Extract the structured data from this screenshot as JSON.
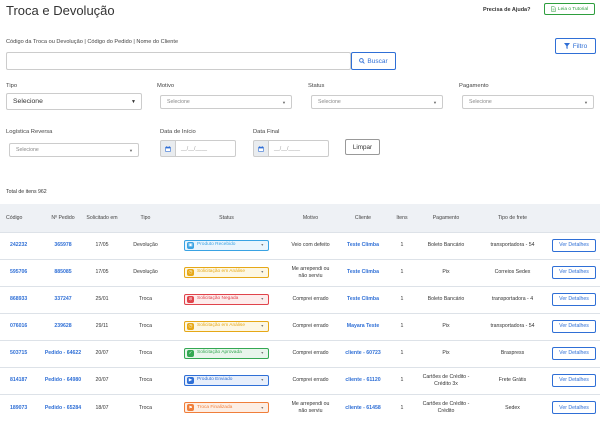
{
  "header": {
    "title": "Troca e Devolução",
    "help_text": "Precisa de Ajuda?",
    "tutorial_label": "Leia o Tutorial"
  },
  "search": {
    "label": "Código da Troca ou Devolução | Código do Pedido | Nome do Cliente",
    "value": "",
    "button_label": "Buscar"
  },
  "filter_button_label": "Filtro",
  "filters": {
    "tipo": {
      "label": "Tipo",
      "value": "Selecione"
    },
    "motivo": {
      "label": "Motivo",
      "value": "Selecione"
    },
    "status": {
      "label": "Status",
      "value": "Selecione"
    },
    "pagamento": {
      "label": "Pagamento",
      "value": "Selecione"
    },
    "logistica": {
      "label": "Logística Reversa",
      "value": "Selecione"
    },
    "data_inicio": {
      "label": "Data de Início",
      "placeholder": "__/__/____"
    },
    "data_final": {
      "label": "Data Final",
      "placeholder": "__/__/____"
    },
    "limpar_label": "Limpar"
  },
  "total_label": "Total de itens 962",
  "table": {
    "headers": [
      "Código",
      "Nº Pedido",
      "Solicitado em",
      "Tipo",
      "Status",
      "Motivo",
      "Cliente",
      "Itens",
      "Pagamento",
      "Tipo de frete",
      ""
    ],
    "rows": [
      {
        "codigo": "242232",
        "pedido": "365978",
        "data": "17/05",
        "tipo": "Devolução",
        "status": "Produto Recebido",
        "status_color": "#3aa3e3",
        "status_bg": "#eaf5fd",
        "status_icon": "box-icon",
        "motivo": "Veio com defeito",
        "cliente": "Teste Climba",
        "itens": "1",
        "pagamento": "Boleto Bancário",
        "frete": "transportadora - 54",
        "acao": "Ver Detalhes"
      },
      {
        "codigo": "595706",
        "pedido": "885085",
        "data": "17/05",
        "tipo": "Devolução",
        "status": "Solicitação em Análise",
        "status_color": "#e6a817",
        "status_bg": "#fdf7e3",
        "status_icon": "clock-icon",
        "motivo": "Me arrependi ou não serviu",
        "cliente": "Teste Climba",
        "itens": "1",
        "pagamento": "Pix",
        "frete": "Correios Sedex",
        "acao": "Ver Detalhes"
      },
      {
        "codigo": "868933",
        "pedido": "337247",
        "data": "25/01",
        "tipo": "Troca",
        "status": "Solicitação Negada",
        "status_color": "#e0434b",
        "status_bg": "#fdecec",
        "status_icon": "ban-icon",
        "motivo": "Comprei errado",
        "cliente": "Teste Climba",
        "itens": "1",
        "pagamento": "Boleto Bancário",
        "frete": "transportadora - 4",
        "acao": "Ver Detalhes"
      },
      {
        "codigo": "076016",
        "pedido": "239628",
        "data": "29/11",
        "tipo": "Troca",
        "status": "Solicitação em Análise",
        "status_color": "#e6a817",
        "status_bg": "#fdf7e3",
        "status_icon": "clock-icon",
        "motivo": "Comprei errado",
        "cliente": "Mayara Teste",
        "itens": "1",
        "pagamento": "Pix",
        "frete": "transportadora - 54",
        "acao": "Ver Detalhes"
      },
      {
        "codigo": "503715",
        "pedido": "Pedido - 64622",
        "data": "20/07",
        "tipo": "Troca",
        "status": "Solicitação Aprovada",
        "status_color": "#34a853",
        "status_bg": "#e8f5ec",
        "status_icon": "check-icon",
        "motivo": "Comprei errado",
        "cliente": "cliente - 60723",
        "itens": "1",
        "pagamento": "Pix",
        "frete": "Braspress",
        "acao": "Ver Detalhes"
      },
      {
        "codigo": "814187",
        "pedido": "Pedido - 64980",
        "data": "20/07",
        "tipo": "Troca",
        "status": "Produto Enviado",
        "status_color": "#2f6fd6",
        "status_bg": "#e8effb",
        "status_icon": "truck-icon",
        "motivo": "Comprei errado",
        "cliente": "cliente - 61120",
        "itens": "1",
        "pagamento": "Cartões de Crédito - Crédito 3x",
        "frete": "Frete Grátis",
        "acao": "Ver Detalhes"
      },
      {
        "codigo": "189073",
        "pedido": "Pedido - 65284",
        "data": "18/07",
        "tipo": "Troca",
        "status": "Troca Finalizada",
        "status_color": "#f07e3a",
        "status_bg": "#fdeee4",
        "status_icon": "flag-icon",
        "motivo": "Me arrependi ou não serviu",
        "cliente": "cliente - 61458",
        "itens": "1",
        "pagamento": "Cartões de Crédito - Crédito",
        "frete": "Sedex",
        "acao": "Ver Detalhes"
      }
    ]
  }
}
